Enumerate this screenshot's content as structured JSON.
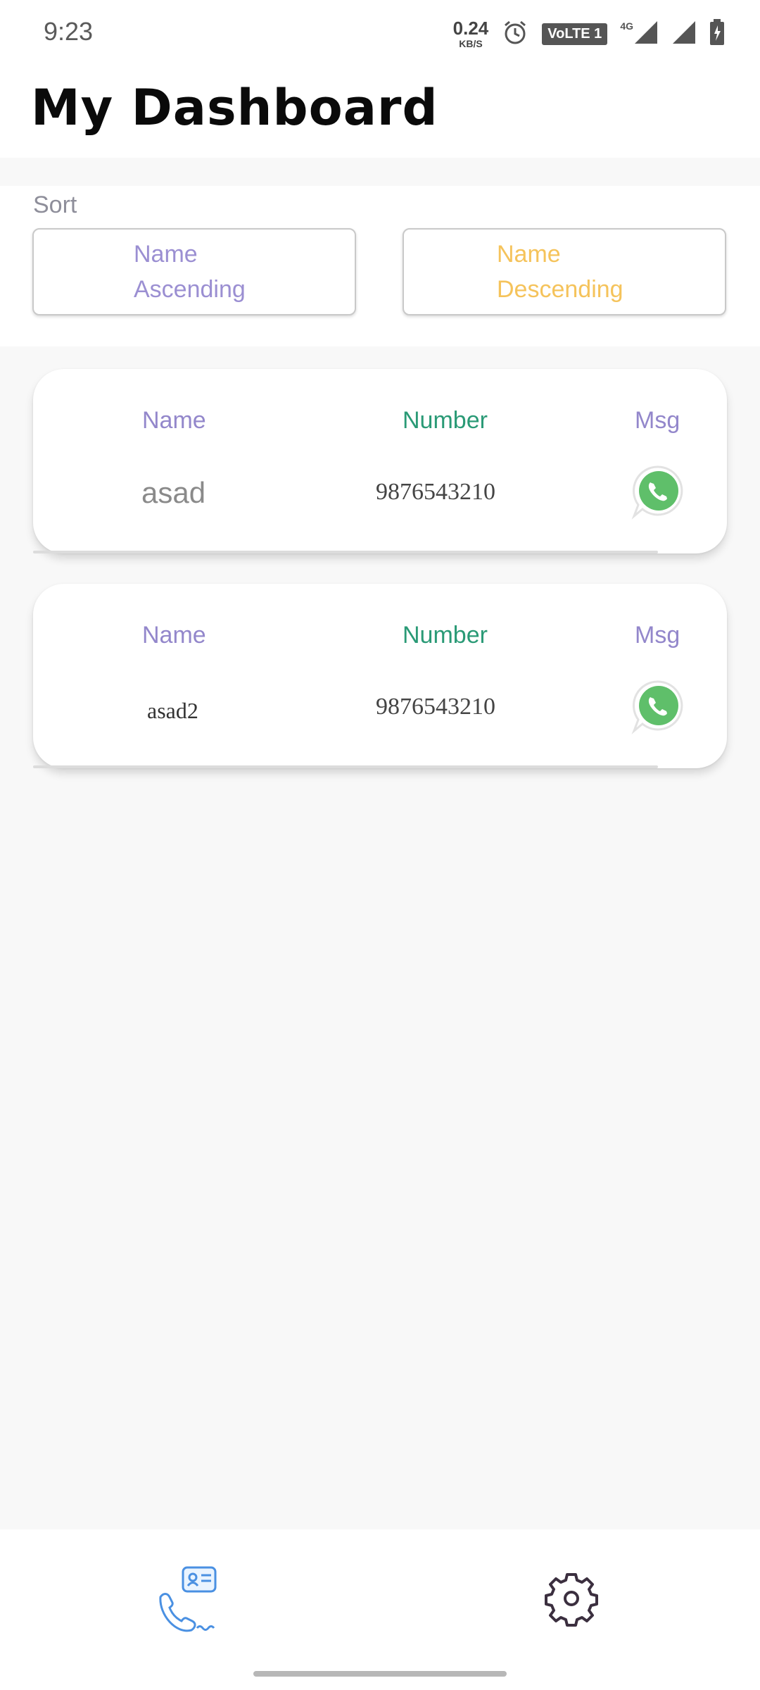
{
  "status_bar": {
    "time": "9:23",
    "network_speed": "0.24",
    "network_speed_unit": "KB/S",
    "volte": "VoLTE 1",
    "network_type": "4G"
  },
  "header": {
    "title": "My Dashboard"
  },
  "sort": {
    "label": "Sort",
    "ascending": {
      "line1": "Name",
      "line2": "Ascending",
      "color": "#9b8fd2"
    },
    "descending": {
      "line1": "Name",
      "line2": "Descending",
      "color": "#f5c35b"
    }
  },
  "columns": {
    "name": "Name",
    "number": "Number",
    "msg": "Msg"
  },
  "contacts": [
    {
      "name": "asad",
      "number": "9876543210"
    },
    {
      "name": "asad2",
      "number": "9876543210"
    }
  ],
  "colors": {
    "accent_purple": "#9387cb",
    "accent_green": "#2a9a76",
    "whatsapp_green": "#5fbf6a"
  },
  "bottom_nav": {
    "items": [
      {
        "icon": "contacts-call-icon"
      },
      {
        "icon": "gear-icon"
      }
    ]
  }
}
